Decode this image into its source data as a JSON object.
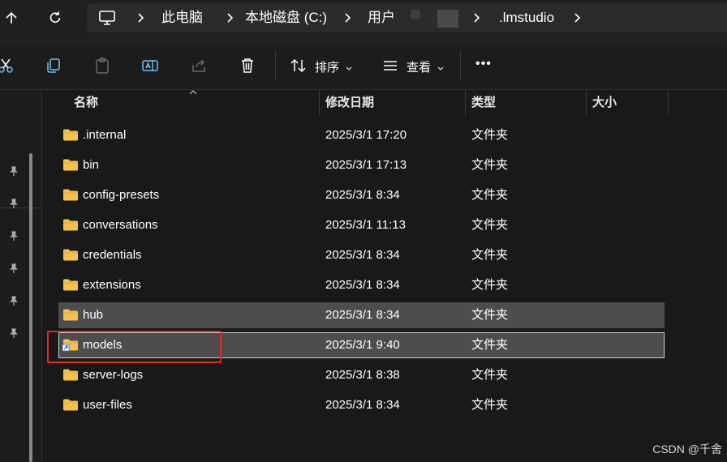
{
  "address_bar": {
    "breadcrumbs": [
      "此电脑",
      "本地磁盘 (C:)",
      "用户",
      ".lmstudio"
    ]
  },
  "toolbar": {
    "sort_label": "排序",
    "view_label": "查看",
    "more_label": "•••"
  },
  "file_list": {
    "columns": [
      "名称",
      "修改日期",
      "类型",
      "大小"
    ],
    "rows": [
      {
        "name": ".internal",
        "date": "2025/3/1 17:20",
        "type": "文件夹"
      },
      {
        "name": "bin",
        "date": "2025/3/1 17:13",
        "type": "文件夹"
      },
      {
        "name": "config-presets",
        "date": "2025/3/1 8:34",
        "type": "文件夹"
      },
      {
        "name": "conversations",
        "date": "2025/3/1 11:13",
        "type": "文件夹"
      },
      {
        "name": "credentials",
        "date": "2025/3/1 8:34",
        "type": "文件夹"
      },
      {
        "name": "extensions",
        "date": "2025/3/1 8:34",
        "type": "文件夹"
      },
      {
        "name": "hub",
        "date": "2025/3/1 8:34",
        "type": "文件夹"
      },
      {
        "name": "models",
        "date": "2025/3/1 9:40",
        "type": "文件夹"
      },
      {
        "name": "server-logs",
        "date": "2025/3/1 8:38",
        "type": "文件夹"
      },
      {
        "name": "user-files",
        "date": "2025/3/1 8:34",
        "type": "文件夹"
      }
    ]
  },
  "watermark": "CSDN @千舍",
  "colors": {
    "background": "#191919",
    "selection": "#4d4d4d",
    "highlight_box": "#e0292a",
    "folder": "#f2c14e"
  }
}
